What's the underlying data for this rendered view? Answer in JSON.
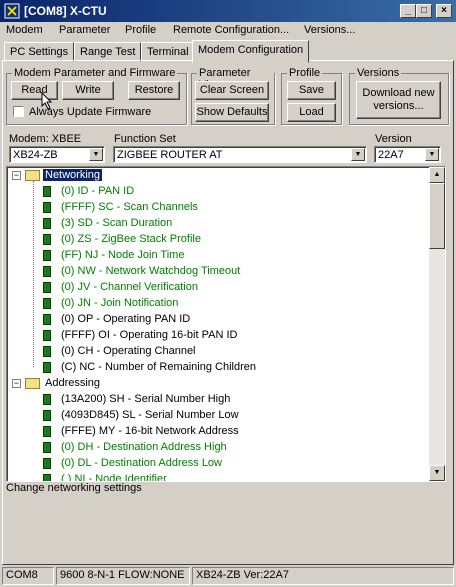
{
  "window": {
    "title": "[COM8] X-CTU"
  },
  "menu": [
    "Modem",
    "Parameter",
    "Profile",
    "Remote Configuration...",
    "Versions..."
  ],
  "tabs": [
    "PC Settings",
    "Range Test",
    "Terminal",
    "Modem Configuration"
  ],
  "groups": {
    "modem_param": {
      "caption": "Modem Parameter and Firmware",
      "read": "Read",
      "write": "Write",
      "restore": "Restore",
      "checkbox": "Always Update Firmware",
      "checkbox_checked": false
    },
    "param_view": {
      "caption": "Parameter View",
      "clear": "Clear Screen",
      "defaults": "Show Defaults"
    },
    "profile": {
      "caption": "Profile",
      "save": "Save",
      "load": "Load"
    },
    "versions": {
      "caption": "Versions",
      "download": "Download new versions..."
    }
  },
  "selectors": {
    "modem_label": "Modem: XBEE",
    "modem_value": "XB24-ZB",
    "function_label": "Function Set",
    "function_value": "ZIGBEE ROUTER AT",
    "version_label": "Version",
    "version_value": "22A7"
  },
  "tree": {
    "networking": "Networking",
    "networking_items": [
      {
        "text": "(0) ID - PAN ID",
        "color": "green"
      },
      {
        "text": "(FFFF) SC - Scan Channels",
        "color": "green"
      },
      {
        "text": "(3) SD - Scan Duration",
        "color": "green"
      },
      {
        "text": "(0) ZS - ZigBee Stack Profile",
        "color": "green"
      },
      {
        "text": "(FF) NJ - Node Join Time",
        "color": "green"
      },
      {
        "text": "(0) NW - Network Watchdog Timeout",
        "color": "green"
      },
      {
        "text": "(0) JV - Channel Verification",
        "color": "green"
      },
      {
        "text": "(0) JN - Join Notification",
        "color": "green"
      },
      {
        "text": "(0) OP - Operating PAN ID",
        "color": "black"
      },
      {
        "text": "(FFFF) OI - Operating 16-bit PAN ID",
        "color": "black"
      },
      {
        "text": "(0) CH - Operating Channel",
        "color": "black"
      },
      {
        "text": "(C) NC - Number of Remaining Children",
        "color": "black"
      }
    ],
    "addressing": "Addressing",
    "addressing_items": [
      {
        "text": "(13A200) SH - Serial Number High",
        "color": "black"
      },
      {
        "text": "(4093D845) SL - Serial Number Low",
        "color": "black"
      },
      {
        "text": "(FFFE) MY - 16-bit Network Address",
        "color": "black"
      },
      {
        "text": "(0) DH - Destination Address High",
        "color": "green"
      },
      {
        "text": "(0) DL - Destination Address Low",
        "color": "green"
      },
      {
        "text": "( ) NI - Node Identifier",
        "color": "green"
      }
    ]
  },
  "description": "Change networking settings",
  "status": {
    "port": "COM8",
    "settings": "9600 8-N-1  FLOW:NONE",
    "modem": "XB24-ZB  Ver:22A7"
  },
  "colors": {
    "green": "#008000",
    "selection": "#0a246a"
  }
}
